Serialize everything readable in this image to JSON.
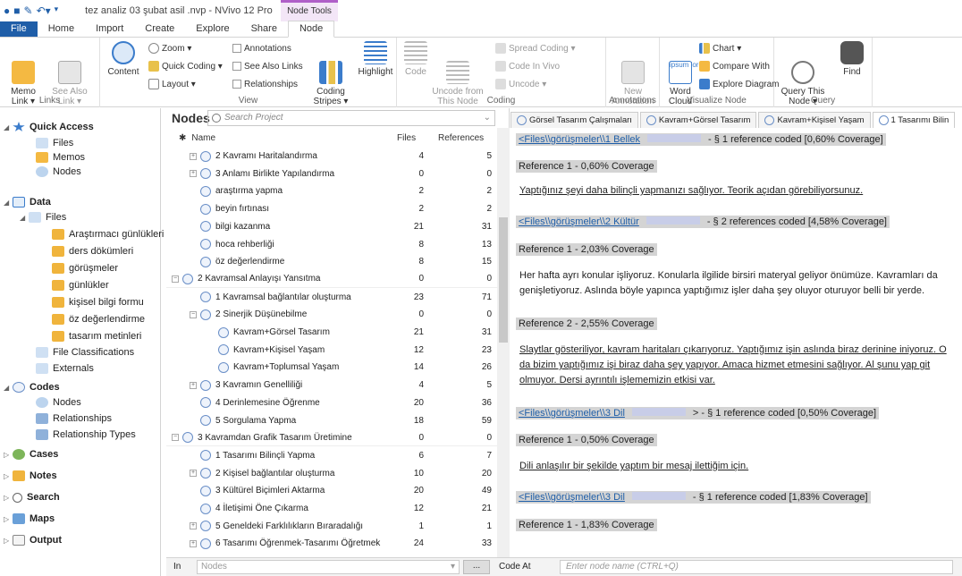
{
  "titlebar": {
    "title": "tez analiz 03 şubat asil .nvp - NVivo 12 Pro",
    "context_tab": "Node Tools"
  },
  "tabs": [
    "File",
    "Home",
    "Import",
    "Create",
    "Explore",
    "Share",
    "Node"
  ],
  "ribbon": {
    "links": {
      "memo": "Memo\nLink ▾",
      "see_also": "See Also\nLink ▾",
      "label": "Links"
    },
    "view": {
      "content": "Content",
      "zoom": "Zoom ▾",
      "quick_coding": "Quick Coding ▾",
      "layout": "Layout ▾",
      "annotations": "Annotations",
      "see_also_links": "See Also Links",
      "relationships": "Relationships",
      "coding_stripes": "Coding\nStripes ▾",
      "highlight": "Highlight",
      "label": "View"
    },
    "coding": {
      "code": "Code",
      "uncode_from": "Uncode from\nThis Node",
      "spread": "Spread Coding ▾",
      "in_vivo": "Code In Vivo",
      "uncode": "Uncode ▾",
      "label": "Coding"
    },
    "annotations": {
      "new": "New\nAnnotation",
      "label": "Annotations"
    },
    "visualize": {
      "word_cloud": "Word\nCloud",
      "chart": "Chart ▾",
      "compare": "Compare With",
      "explore_diagram": "Explore Diagram",
      "label": "Visualize Node"
    },
    "query": {
      "query_this": "Query This\nNode ▾",
      "find": "Find",
      "label": "Query"
    }
  },
  "nav": [
    {
      "label": "Quick Access",
      "bold": true
    },
    {
      "label": "Files"
    },
    {
      "label": "Memos"
    },
    {
      "label": "Nodes"
    },
    {
      "label": "Data",
      "bold": true
    },
    {
      "label": "Files"
    },
    {
      "label": "Araştırmacı günlükleri"
    },
    {
      "label": "ders dökümleri"
    },
    {
      "label": "görüşmeler"
    },
    {
      "label": "günlükler"
    },
    {
      "label": "kişisel bilgi formu"
    },
    {
      "label": "öz değerlendirme"
    },
    {
      "label": "tasarım metinleri"
    },
    {
      "label": "File Classifications"
    },
    {
      "label": "Externals"
    },
    {
      "label": "Codes",
      "bold": true
    },
    {
      "label": "Nodes"
    },
    {
      "label": "Relationships"
    },
    {
      "label": "Relationship Types"
    },
    {
      "label": "Cases",
      "bold": true
    },
    {
      "label": "Notes",
      "bold": true
    },
    {
      "label": "Search",
      "bold": true
    },
    {
      "label": "Maps",
      "bold": true
    },
    {
      "label": "Output",
      "bold": true
    }
  ],
  "nodes_pane": {
    "title": "Nodes",
    "search_placeholder": "Search Project",
    "columns": {
      "name": "Name",
      "files": "Files",
      "references": "References"
    },
    "rows": [
      {
        "name": "2 Kavramı Haritalandırma",
        "files": "4",
        "refs": "5"
      },
      {
        "name": "3 Anlamı Birlikte Yapılandırma",
        "files": "0",
        "refs": "0"
      },
      {
        "name": "araştırma yapma",
        "files": "2",
        "refs": "2"
      },
      {
        "name": "beyin fırtınası",
        "files": "2",
        "refs": "2"
      },
      {
        "name": "bilgi kazanma",
        "files": "21",
        "refs": "31"
      },
      {
        "name": "hoca rehberliği",
        "files": "8",
        "refs": "13"
      },
      {
        "name": "öz değerlendirme",
        "files": "8",
        "refs": "15"
      },
      {
        "name": "2 Kavramsal Anlayışı Yansıtma",
        "files": "0",
        "refs": "0"
      },
      {
        "name": "1 Kavramsal bağlantılar oluşturma",
        "files": "23",
        "refs": "71"
      },
      {
        "name": "2 Sinerjik Düşünebilme",
        "files": "0",
        "refs": "0"
      },
      {
        "name": "Kavram+Görsel Tasarım",
        "files": "21",
        "refs": "31"
      },
      {
        "name": "Kavram+Kişisel Yaşam",
        "files": "12",
        "refs": "23"
      },
      {
        "name": "Kavram+Toplumsal Yaşam",
        "files": "14",
        "refs": "26"
      },
      {
        "name": "3 Kavramın Genelliliği",
        "files": "4",
        "refs": "5"
      },
      {
        "name": "4 Derinlemesine Öğrenme",
        "files": "20",
        "refs": "36"
      },
      {
        "name": "5 Sorgulama Yapma",
        "files": "18",
        "refs": "59"
      },
      {
        "name": "3 Kavramdan Grafik Tasarım Üretimine",
        "files": "0",
        "refs": "0"
      },
      {
        "name": "1 Tasarımı Bilinçli Yapma",
        "files": "6",
        "refs": "7"
      },
      {
        "name": "2 Kişisel bağlantılar oluşturma",
        "files": "10",
        "refs": "20"
      },
      {
        "name": "3 Kültürel Biçimleri Aktarma",
        "files": "20",
        "refs": "49"
      },
      {
        "name": "4 İletişimi Öne Çıkarma",
        "files": "12",
        "refs": "21"
      },
      {
        "name": "5 Geneldeki Farklılıkların Bıraradalığı",
        "files": "1",
        "refs": "1"
      },
      {
        "name": "6 Tasarımı Öğrenmek-Tasarımı Öğretmek",
        "files": "24",
        "refs": "33"
      }
    ]
  },
  "bottombar": {
    "in": "In",
    "nodes": "Nodes",
    "code_at": "Code At",
    "node_placeholder": "Enter node name (CTRL+Q)"
  },
  "detail": {
    "tabs": [
      "Görsel Tasarım Çalışmaları",
      "Kavram+Görsel Tasarım",
      "Kavram+Kişisel Yaşam",
      "1 Tasarımı Bilin"
    ],
    "blocks": [
      {
        "link": "<Files\\\\görüşmeler\\\\1 Bellek",
        "tail": "- § 1 reference coded  [0,60% Coverage]"
      },
      {
        "ref": "Reference 1 - 0,60% Coverage"
      },
      {
        "text": "Yaptığınız şeyi daha bilinçli yapmanızı sağlıyor. Teorik açıdan görebiliyorsunuz."
      },
      {
        "link": "<Files\\\\görüşmeler\\\\2 Kültür",
        "tail": "- § 2 references coded  [4,58% Coverage]"
      },
      {
        "ref": "Reference 1 - 2,03% Coverage"
      },
      {
        "text": "Her hafta ayrı konular işliyoruz. Konularla ilgilide birsiri materyal geliyor önümüze. Kavramları da genişletiyoruz. Aslında böyle yapınca yaptığımız işler daha şey oluyor oturuyor belli bir yerde."
      },
      {
        "ref": "Reference 2 - 2,55% Coverage"
      },
      {
        "text": "Slaytlar gösteriliyor, kavram haritaları çıkarıyoruz. Yaptığımız işin aslında biraz derinine iniyoruz. O da bizim yaptığımız işi biraz daha şey yapıyor. Amaca hizmet etmesini sağlıyor. Al şunu yap git olmuyor. Dersi ayrıntılı işlememizin etkisi var."
      },
      {
        "link": "<Files\\\\görüşmeler\\\\3 Dil",
        "tail": "> - § 1 reference coded  [0,50% Coverage]"
      },
      {
        "ref": "Reference 1 - 0,50% Coverage"
      },
      {
        "text": "Dili anlaşılır bir şekilde yaptım bir mesaj ilettiğim için."
      },
      {
        "link": "<Files\\\\görüşmeler\\\\3 Dil",
        "tail": "- § 1 reference coded  [1,83% Coverage]"
      },
      {
        "ref": "Reference 1 - 1,83% Coverage"
      }
    ]
  }
}
